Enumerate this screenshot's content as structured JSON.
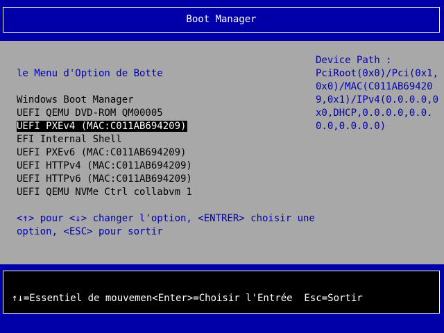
{
  "window": {
    "title": "Boot Manager"
  },
  "prompt": "le Menu d'Option de Botte",
  "device_path": {
    "label": "Device Path :",
    "value": "PciRoot(0x0)/Pci(0x1,0x0)/MAC(C011AB694209,0x1)/IPv4(0.0.0.0,0x0,DHCP,0.0.0.0,0.0.0.0,0.0.0.0)"
  },
  "boot_options": [
    {
      "label": "Windows Boot Manager",
      "selected": false
    },
    {
      "label": "UEFI QEMU DVD-ROM QM00005",
      "selected": false
    },
    {
      "label": "UEFI PXEv4 (MAC:C011AB694209)",
      "selected": true
    },
    {
      "label": "EFI Internal Shell",
      "selected": false
    },
    {
      "label": "UEFI PXEv6 (MAC:C011AB694209)",
      "selected": false
    },
    {
      "label": "UEFI HTTPv4 (MAC:C011AB694209)",
      "selected": false
    },
    {
      "label": "UEFI HTTPv6 (MAC:C011AB694209)",
      "selected": false
    },
    {
      "label": "UEFI QEMU NVMe Ctrl collabvm 1",
      "selected": false
    }
  ],
  "help_text": "<↑> pour <↓> changer l'option, <ENTRER> choisir une option, <ESC> pour sortir",
  "footer": {
    "hint": "↑↓=Essentiel de mouvemen<Enter>=Choisir l'Entrée  Esc=Sortir"
  },
  "colors": {
    "background": "#0000a8",
    "panel": "#a8a8a8",
    "text_blue": "#0000a8",
    "selection": "#000000"
  }
}
